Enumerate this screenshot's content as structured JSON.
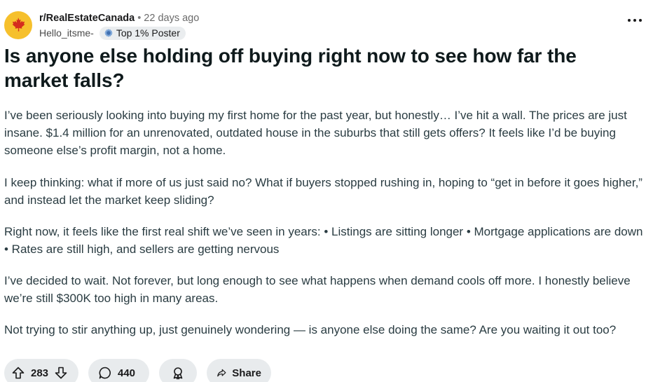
{
  "post": {
    "subreddit": "r/RealEstateCanada",
    "separator": "•",
    "time_ago": "22 days ago",
    "author": "Hello_itsme-",
    "flair": "Top 1% Poster",
    "title": "Is anyone else holding off buying right now to see how far the market falls?",
    "paragraphs": [
      "I’ve been seriously looking into buying my first home for the past year, but honestly… I’ve hit a wall. The prices are just insane. $1.4 million for an unrenovated, outdated house in the suburbs that still gets offers? It feels like I’d be buying someone else’s profit margin, not a home.",
      "I keep thinking: what if more of us just said no? What if buyers stopped rushing in, hoping to “get in before it goes higher,” and instead let the market keep sliding?",
      "Right now, it feels like the first real shift we’ve seen in years: • Listings are sitting longer • Mortgage applications are down • Rates are still high, and sellers are getting nervous",
      "I’ve decided to wait. Not forever, but long enough to see what happens when demand cools off more. I honestly believe we’re still $300K too high in many areas.",
      "Not trying to stir anything up, just genuinely wondering — is anyone else doing the same? Are you waiting it out too?"
    ]
  },
  "actions": {
    "upvotes": "283",
    "comments": "440",
    "share_label": "Share"
  },
  "icons": {
    "avatar": "maple-leaf-icon",
    "flair": "achievement-badge-icon",
    "more": "more-options-icon",
    "upvote": "upvote-arrow-icon",
    "downvote": "downvote-arrow-icon",
    "comment": "comment-bubble-icon",
    "award": "award-icon",
    "share": "share-arrow-icon"
  },
  "colors": {
    "avatar_bg": "#f6c02c",
    "maple_leaf": "#d52b1e",
    "pill_bg": "#e8ebed"
  }
}
